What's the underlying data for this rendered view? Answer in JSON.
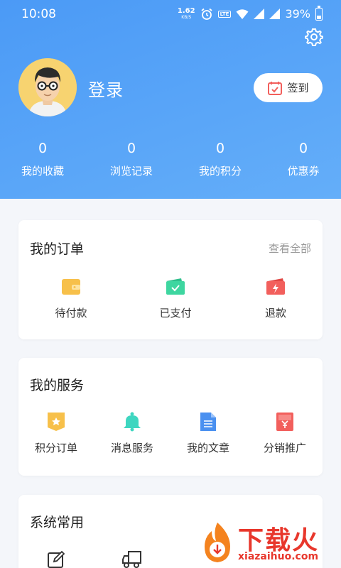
{
  "status_bar": {
    "time": "10:08",
    "speed_value": "1.62",
    "speed_unit": "KB/S",
    "lte_label": "LTE",
    "battery": "39%",
    "battery_level": 0.39
  },
  "profile": {
    "login_label": "登录",
    "checkin_label": "签到"
  },
  "stats": [
    {
      "value": "0",
      "label": "我的收藏"
    },
    {
      "value": "0",
      "label": "浏览记录"
    },
    {
      "value": "0",
      "label": "我的积分"
    },
    {
      "value": "0",
      "label": "优惠券"
    }
  ],
  "orders": {
    "title": "我的订单",
    "view_all": "查看全部",
    "items": [
      {
        "label": "待付款",
        "icon": "wallet-icon",
        "color": "#f7c04a"
      },
      {
        "label": "已支付",
        "icon": "paid-icon",
        "color": "#3ed6a0"
      },
      {
        "label": "退款",
        "icon": "refund-icon",
        "color": "#f25f5c"
      }
    ]
  },
  "services": {
    "title": "我的服务",
    "items": [
      {
        "label": "积分订单",
        "icon": "points-order-icon",
        "color": "#f7c04a"
      },
      {
        "label": "消息服务",
        "icon": "bell-icon",
        "color": "#3ed6c0"
      },
      {
        "label": "我的文章",
        "icon": "document-icon",
        "color": "#4a90f0"
      },
      {
        "label": "分销推广",
        "icon": "distribution-icon",
        "color": "#f25f5c"
      }
    ]
  },
  "system": {
    "title": "系统常用"
  },
  "watermark": {
    "text": "下载火",
    "url": "xiazaihuo.com"
  },
  "colors": {
    "header_blue": "#4b9af6",
    "accent_red": "#e8372c"
  }
}
